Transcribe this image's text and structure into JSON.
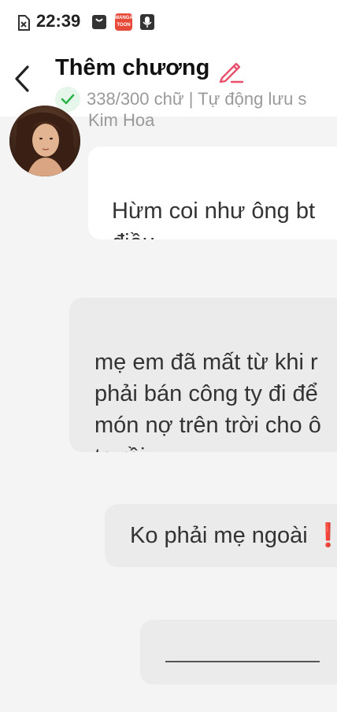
{
  "status_bar": {
    "time": "22:39",
    "icons": [
      "sim-card-x-icon",
      "shopping-bag-icon",
      "manga-toon-app-icon",
      "microphone-icon"
    ],
    "app_icon_text": "MANGA TOON"
  },
  "header": {
    "title": "Thêm chương",
    "word_count": "338/300 chữ | Tự động lưu s",
    "accent_color": "#e8506c",
    "check_color": "#2db34a"
  },
  "messages": [
    {
      "sender": "Kim Hoa",
      "text": "Hừm coi như ông bt\nđiều",
      "side": "left"
    },
    {
      "text": "mẹ em đã mất từ khi r\nphải bán công ty đi để\nmón nợ trên trời cho ô\nta rồi",
      "side": "right"
    },
    {
      "text": "Ko phải mẹ ngoài",
      "suffix": "❗",
      "side": "right"
    },
    {
      "text": "",
      "side": "right",
      "is_input": true
    }
  ]
}
